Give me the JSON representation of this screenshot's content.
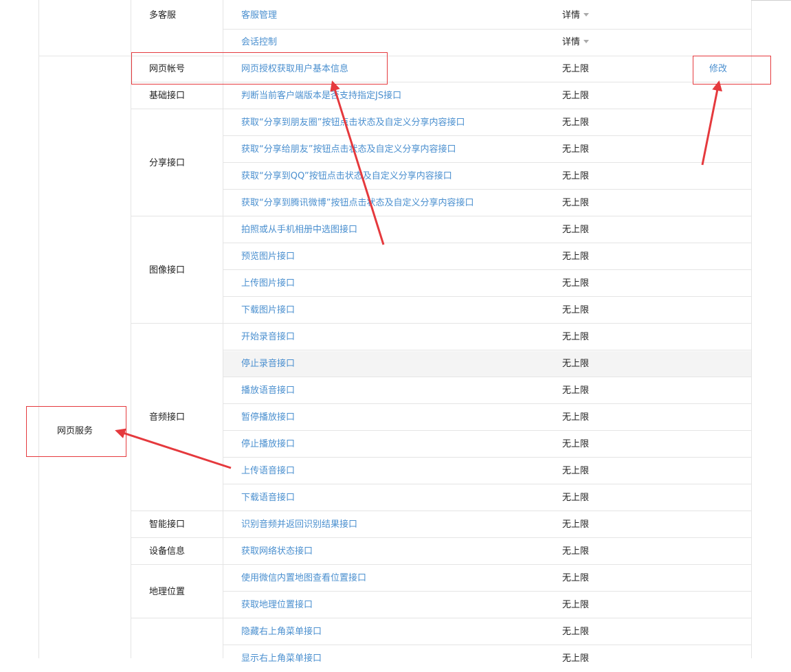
{
  "group": {
    "label": "网页服务"
  },
  "top_group": {
    "category": "多客服",
    "rows": [
      {
        "api": "客服管理",
        "detail": "详情"
      },
      {
        "api": "会话控制",
        "detail": "详情"
      }
    ]
  },
  "categories": [
    {
      "label": "网页帐号",
      "rows": [
        {
          "api": "网页授权获取用户基本信息",
          "quota": "无上限",
          "action": "修改"
        }
      ]
    },
    {
      "label": "基础接口",
      "rows": [
        {
          "api": "判断当前客户端版本是否支持指定JS接口",
          "quota": "无上限"
        }
      ]
    },
    {
      "label": "分享接口",
      "rows": [
        {
          "api": "获取“分享到朋友圈”按钮点击状态及自定义分享内容接口",
          "quota": "无上限"
        },
        {
          "api": "获取“分享给朋友”按钮点击状态及自定义分享内容接口",
          "quota": "无上限"
        },
        {
          "api": "获取“分享到QQ”按钮点击状态及自定义分享内容接口",
          "quota": "无上限"
        },
        {
          "api": "获取“分享到腾讯微博”按钮点击状态及自定义分享内容接口",
          "quota": "无上限"
        }
      ]
    },
    {
      "label": "图像接口",
      "rows": [
        {
          "api": "拍照或从手机相册中选图接口",
          "quota": "无上限"
        },
        {
          "api": "预览图片接口",
          "quota": "无上限"
        },
        {
          "api": "上传图片接口",
          "quota": "无上限"
        },
        {
          "api": "下载图片接口",
          "quota": "无上限"
        }
      ]
    },
    {
      "label": "音频接口",
      "rows": [
        {
          "api": "开始录音接口",
          "quota": "无上限"
        },
        {
          "api": "停止录音接口",
          "quota": "无上限"
        },
        {
          "api": "播放语音接口",
          "quota": "无上限"
        },
        {
          "api": "暂停播放接口",
          "quota": "无上限"
        },
        {
          "api": "停止播放接口",
          "quota": "无上限"
        },
        {
          "api": "上传语音接口",
          "quota": "无上限"
        },
        {
          "api": "下载语音接口",
          "quota": "无上限"
        }
      ]
    },
    {
      "label": "智能接口",
      "rows": [
        {
          "api": "识别音频并返回识别结果接口",
          "quota": "无上限"
        }
      ]
    },
    {
      "label": "设备信息",
      "rows": [
        {
          "api": "获取网络状态接口",
          "quota": "无上限"
        }
      ]
    },
    {
      "label": "地理位置",
      "rows": [
        {
          "api": "使用微信内置地图查看位置接口",
          "quota": "无上限"
        },
        {
          "api": "获取地理位置接口",
          "quota": "无上限"
        }
      ]
    },
    {
      "label": "",
      "rows": [
        {
          "api": "隐藏右上角菜单接口",
          "quota": "无上限"
        },
        {
          "api": "显示右上角菜单接口",
          "quota": "无上限"
        }
      ]
    }
  ],
  "annotation_color": "#e5393d",
  "link_color": "#4a8fcf"
}
